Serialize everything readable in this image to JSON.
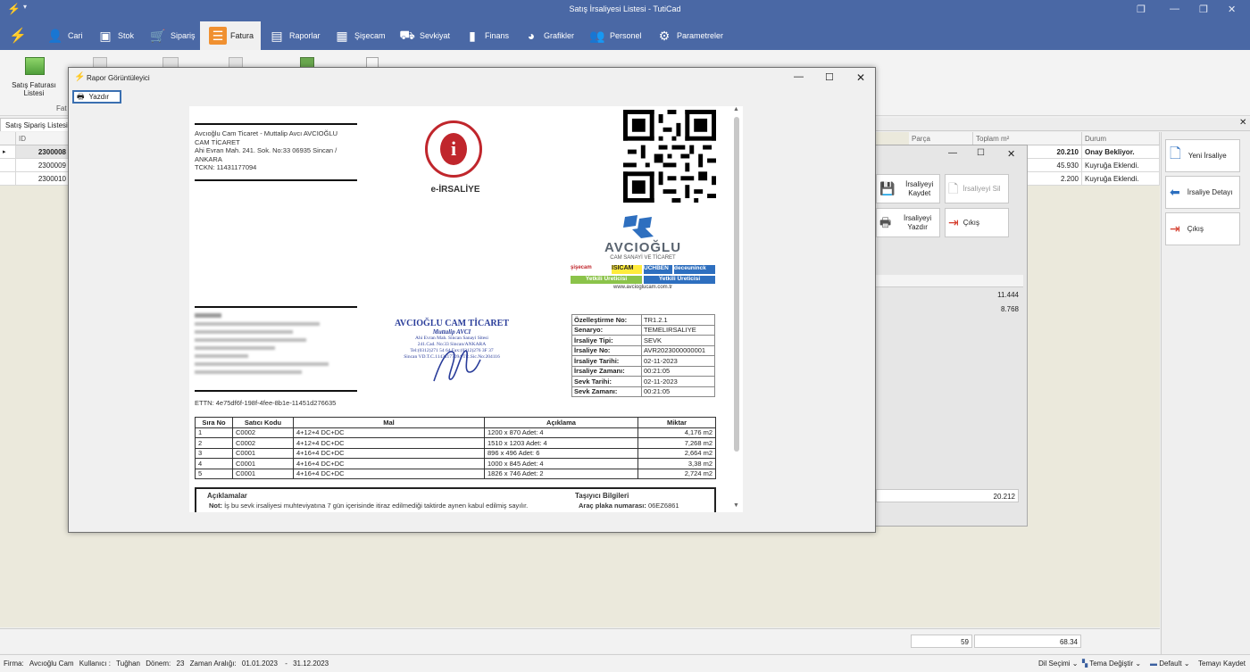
{
  "window": {
    "title": "Satış İrsaliyesi Listesi - TutiCad"
  },
  "menu": [
    {
      "label": "Cari",
      "icon": "user-icon"
    },
    {
      "label": "Stok",
      "icon": "box-icon"
    },
    {
      "label": "Sipariş",
      "icon": "order-icon"
    },
    {
      "label": "Fatura",
      "icon": "invoice-icon",
      "active": true
    },
    {
      "label": "Raporlar",
      "icon": "report-icon"
    },
    {
      "label": "Şişecam",
      "icon": "grid-icon"
    },
    {
      "label": "Sevkiyat",
      "icon": "truck-icon"
    },
    {
      "label": "Finans",
      "icon": "bar-chart-icon"
    },
    {
      "label": "Grafikler",
      "icon": "pie-chart-icon"
    },
    {
      "label": "Personel",
      "icon": "people-icon"
    },
    {
      "label": "Parametreler",
      "icon": "gear-icon"
    }
  ],
  "ribbon": {
    "first_button": "Satış Faturası Listesi",
    "group_label": "Fat"
  },
  "tabs": {
    "active": "Satış Sipariş Listesi"
  },
  "grid": {
    "headers": {
      "id": "ID",
      "parca": "Parça",
      "toplam": "Toplam m²",
      "durum": "Durum"
    },
    "rows": [
      {
        "id": "2300008",
        "toplam": "20.210",
        "durum": "Onay Bekliyor.",
        "bold": true
      },
      {
        "id": "2300009",
        "toplam": "45.930",
        "durum": "Kuyruğa Eklendi."
      },
      {
        "id": "2300010",
        "toplam": "2.200",
        "durum": "Kuyruğa Eklendi."
      }
    ],
    "footer": {
      "parca": "59",
      "toplam": "68.34"
    }
  },
  "right_buttons": [
    {
      "label": "Yeni İrsaliye",
      "icon": "new-document-icon"
    },
    {
      "label": "İrsaliye Detayı",
      "icon": "arrow-left-icon"
    },
    {
      "label": "Çıkış",
      "icon": "exit-icon"
    }
  ],
  "sub_window": {
    "buttons": [
      {
        "label": "İrsaliyeyi Kaydet",
        "icon": "save-icon"
      },
      {
        "label": "İrsaliyeyi Sil",
        "icon": "delete-document-icon"
      },
      {
        "label": "İrsaliyeyi Yazdır",
        "icon": "printer-icon"
      },
      {
        "label": "Çıkış",
        "icon": "exit-icon"
      }
    ],
    "values": [
      "11.444",
      "8.768",
      "20.212"
    ]
  },
  "dialog": {
    "title": "Rapor Görüntüleyici",
    "print_button": "Yazdır",
    "document": {
      "sender_lines": [
        "Avcıoğlu Cam Ticaret - Muttalip Avcı AVCIOĞLU",
        "CAM TİCARET",
        "Ahi Evran Mah. 241. Sok. No:33 06935 Sincan /",
        "ANKARA",
        "TCKN: 11431177094"
      ],
      "doc_type": "e-İRSALİYE",
      "brand": {
        "name": "AVCIOĞLU",
        "tagline": "CAM SANAYİ VE TİCARET",
        "logos": [
          "şişecam",
          "ISICAM",
          "UCHBEN",
          "deceuninck"
        ],
        "badge1": "Yetkili Üreticisi",
        "badge2": "Yetkili Üreticisi",
        "website": "www.avcioglucam.com.tr"
      },
      "stamp": {
        "title": "AVCIOĞLU CAM TİCARET",
        "sub": "Muttalip AVCI",
        "lines": [
          "Ahi Evran Mah. Sincan Sanayi Sitesi",
          "241.Cad. No:33 Sincan/ANKARA",
          "Tel:(0312)271 54 64 Fax:(0312)276 3F 37",
          "Sincan VD.T.C.11431177094 Tic.Sic.No:204116"
        ]
      },
      "info": [
        {
          "k": "Özelleştirme No:",
          "v": "TR1.2.1"
        },
        {
          "k": "Senaryo:",
          "v": "TEMELIRSALIYE"
        },
        {
          "k": "İrsaliye Tipi:",
          "v": "SEVK"
        },
        {
          "k": "İrsaliye No:",
          "v": "AVR2023000000001"
        },
        {
          "k": "İrsaliye Tarihi:",
          "v": "02-11-2023"
        },
        {
          "k": "İrsaliye Zamanı:",
          "v": "00:21:05"
        },
        {
          "k": "Sevk Tarihi:",
          "v": "02-11-2023"
        },
        {
          "k": "Sevk Zamanı:",
          "v": "00:21:05"
        }
      ],
      "ettn": "ETTN: 4e75df6f-198f-4fee-8b1e-11451d276635",
      "items_headers": [
        "Sıra No",
        "Satıcı Kodu",
        "Mal",
        "Açıklama",
        "Miktar"
      ],
      "items": [
        [
          "1",
          "C0002",
          "4+12+4 DC+DC",
          "1200 x 870 Adet: 4",
          "4,176 m2"
        ],
        [
          "2",
          "C0002",
          "4+12+4 DC+DC",
          "1510 x 1203 Adet: 4",
          "7,268 m2"
        ],
        [
          "3",
          "C0001",
          "4+16+4 DC+DC",
          "896 x 496 Adet: 6",
          "2,664 m2"
        ],
        [
          "4",
          "C0001",
          "4+16+4 DC+DC",
          "1000 x 845 Adet: 4",
          "3,38 m2"
        ],
        [
          "5",
          "C0001",
          "4+16+4 DC+DC",
          "1826 x 746 Adet: 2",
          "2,724 m2"
        ]
      ],
      "notes_title": "Açıklamalar",
      "note_label": "Not:",
      "note_text": "İş bu sevk irsaliyesi muhteviyatına 7 gün içerisinde itiraz edilmediği taktirde aynen kabul edilmiş sayılır.",
      "carrier_title": "Taşıyıcı Bilgileri",
      "plate_label": "Araç plaka numarası:",
      "plate": "06EZ6861"
    }
  },
  "status": {
    "firma_label": "Firma:",
    "firma": "Avcıoğlu Cam",
    "kullanici_label": "Kullanıcı :",
    "kullanici": "Tuğhan",
    "donem_label": "Dönem:",
    "donem": "23",
    "aralik_label": "Zaman Aralığı:",
    "aralik_start": "01.01.2023",
    "aralik_end": "31.12.2023",
    "right": [
      "Dil Seçimi",
      "Tema Değiştir",
      "Default",
      "Temayı Kaydet"
    ]
  }
}
